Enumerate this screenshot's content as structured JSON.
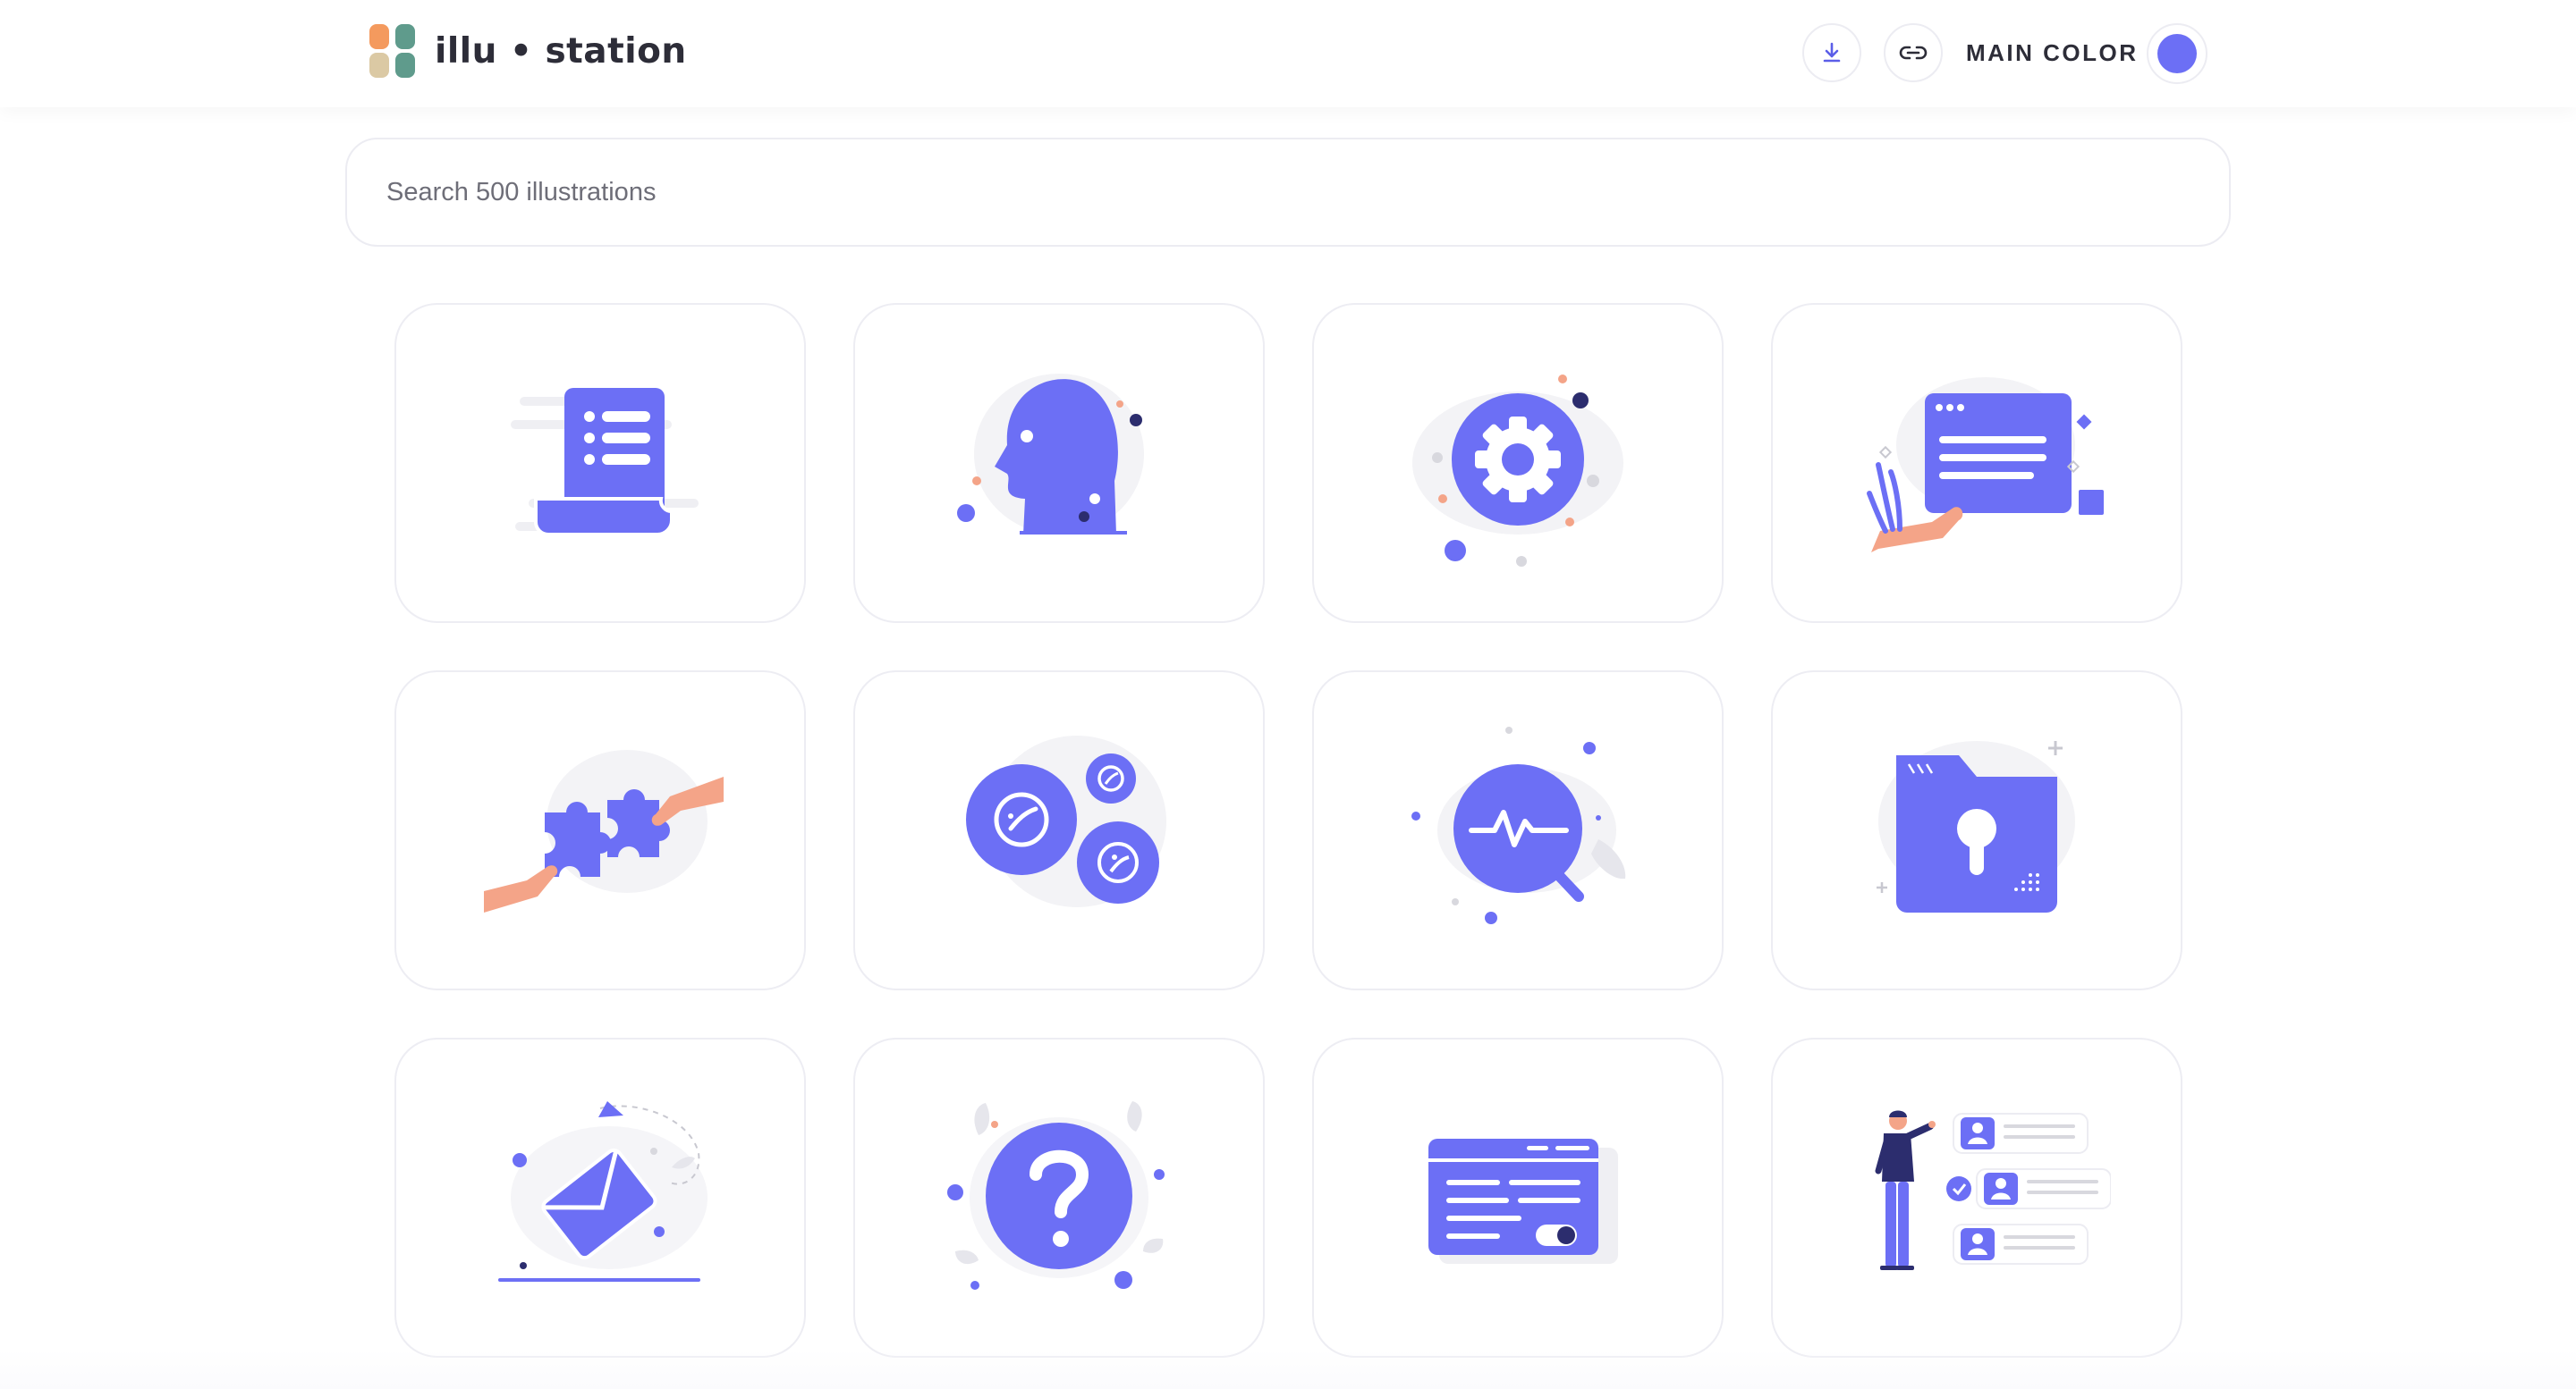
{
  "app": {
    "logo_text": "illu • station"
  },
  "header": {
    "download_icon": "download-icon",
    "link_icon": "link-icon",
    "main_color_label": "MAIN COLOR",
    "main_color": "#6c6ff5"
  },
  "search": {
    "placeholder": "Search 500 illustrations",
    "value": ""
  },
  "illustrations": [
    {
      "icon": "document-list-illustration"
    },
    {
      "icon": "human-head-illustration"
    },
    {
      "icon": "gear-settings-illustration"
    },
    {
      "icon": "browser-window-in-hand-illustration"
    },
    {
      "icon": "puzzle-pieces-illustration"
    },
    {
      "icon": "planets-circles-illustration"
    },
    {
      "icon": "magnifier-pulse-illustration"
    },
    {
      "icon": "locked-folder-illustration"
    },
    {
      "icon": "paper-plane-envelope-illustration"
    },
    {
      "icon": "question-mark-illustration"
    },
    {
      "icon": "card-toggle-illustration"
    },
    {
      "icon": "person-user-list-illustration"
    }
  ],
  "colors": {
    "accent": "#6c6ff5",
    "skin": "#f4a488",
    "dark": "#2c2d6e",
    "light_gray": "#efeff3"
  }
}
